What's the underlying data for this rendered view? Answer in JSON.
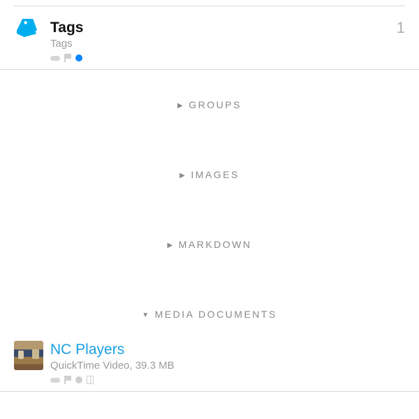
{
  "tagsItem": {
    "title": "Tags",
    "subtitle": "Tags",
    "count": "1",
    "iconColor": "#00aeef",
    "dotColor": "#0a84ff"
  },
  "sections": [
    {
      "label": "GROUPS",
      "expanded": false
    },
    {
      "label": "IMAGES",
      "expanded": false
    },
    {
      "label": "MARKDOWN",
      "expanded": false
    },
    {
      "label": "MEDIA DOCUMENTS",
      "expanded": true
    }
  ],
  "mediaItem": {
    "title": "NC Players",
    "subtitle": "QuickTime Video, 39.3 MB"
  },
  "glyphs": {
    "collapsed": "▶",
    "expanded": "▼"
  }
}
